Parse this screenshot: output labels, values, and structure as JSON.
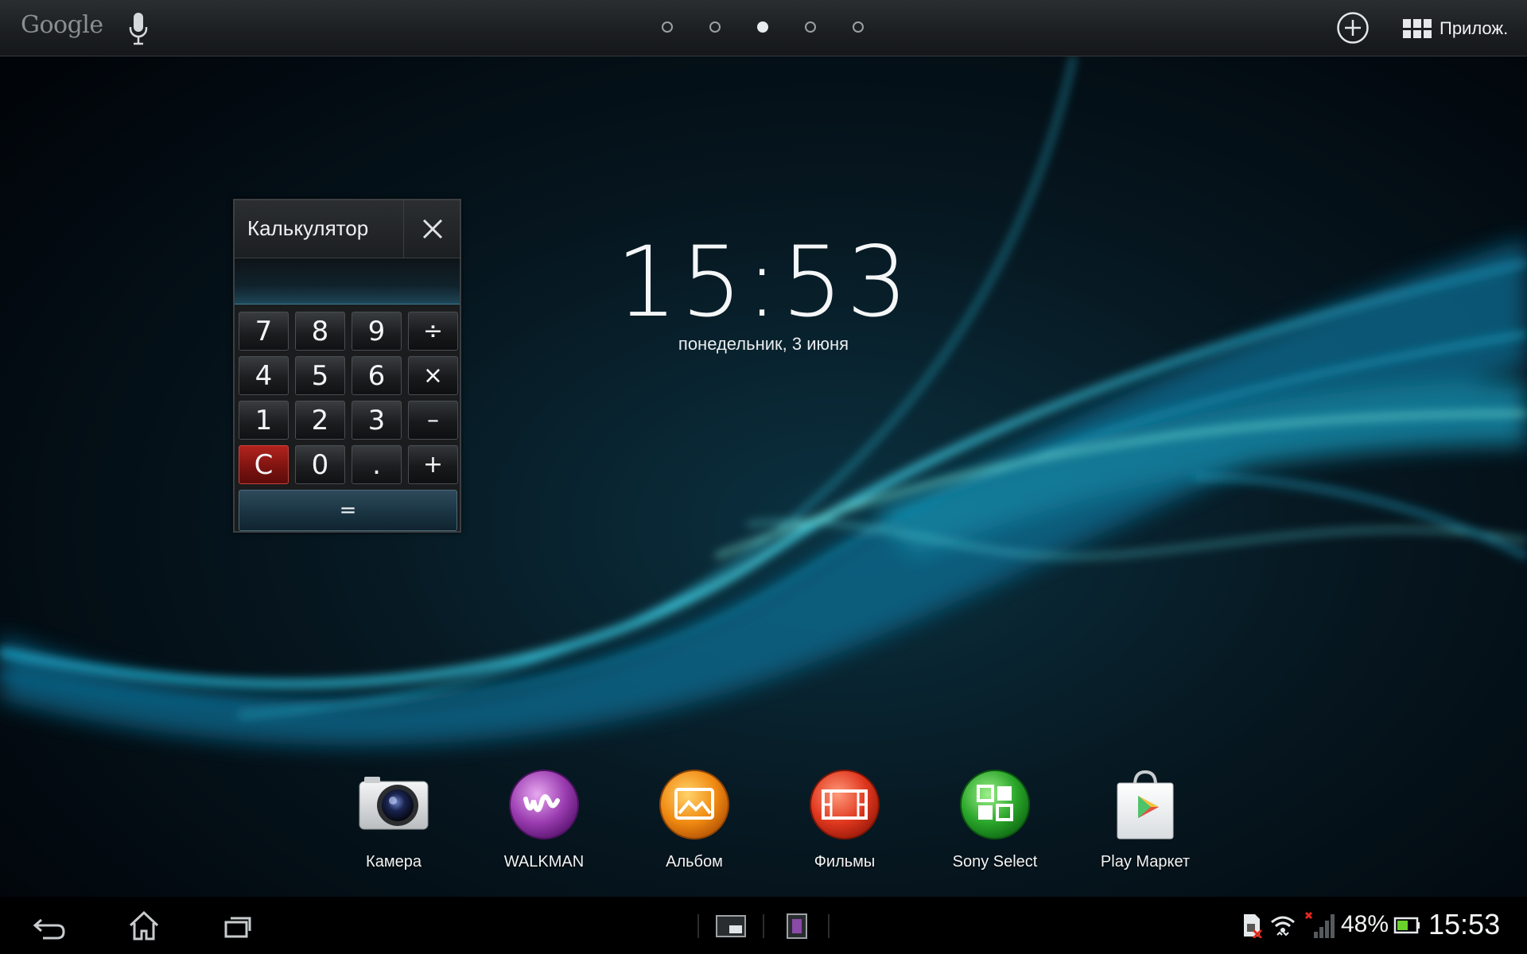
{
  "topbar": {
    "google_label": "Google",
    "icons": [
      "mic-icon",
      "plus-circle-icon",
      "apps-grid-icon"
    ],
    "pages": [
      {
        "active": false
      },
      {
        "active": false
      },
      {
        "active": true
      },
      {
        "active": false
      },
      {
        "active": false
      }
    ],
    "apps_label": "Прилож."
  },
  "calculator": {
    "title": "Калькулятор",
    "display_value": "",
    "keys": [
      "7",
      "8",
      "9",
      "÷",
      "4",
      "5",
      "6",
      "×",
      "1",
      "2",
      "3",
      "–",
      "C",
      "0",
      ".",
      "+"
    ],
    "equals_label": "="
  },
  "clock": {
    "time": "15:53",
    "date": "понедельник, 3 июня"
  },
  "dock": {
    "apps": [
      {
        "label": "Камера",
        "icon": "camera-icon"
      },
      {
        "label": "WALKMAN",
        "icon": "walkman-icon"
      },
      {
        "label": "Альбом",
        "icon": "album-icon"
      },
      {
        "label": "Фильмы",
        "icon": "movies-icon"
      },
      {
        "label": "Sony Select",
        "icon": "sony-select-icon"
      },
      {
        "label": "Play Маркет",
        "icon": "play-store-icon"
      }
    ]
  },
  "statusbar": {
    "battery_percent": "48%",
    "time": "15:53",
    "icons": [
      "back-icon",
      "home-icon",
      "recent-apps-icon",
      "small-app-icon",
      "small-app-2-icon",
      "sim-error-icon",
      "wifi-icon",
      "signal-icon",
      "battery-icon"
    ]
  },
  "colors": {
    "wallpaper_accent": "#2fb8d8",
    "clear_key": "#a11c17",
    "equals_key": "#1e3a4a"
  }
}
